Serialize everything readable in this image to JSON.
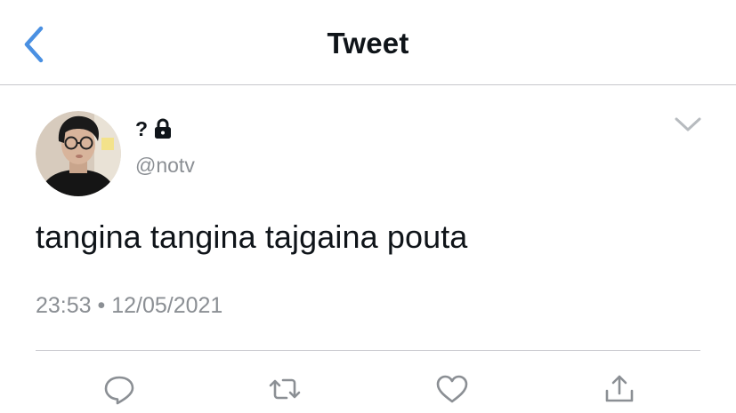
{
  "header": {
    "title": "Tweet",
    "back_icon": "chevron-left-icon",
    "accent_color": "#4a90e2"
  },
  "tweet": {
    "display_name": "?",
    "lock_icon": "lock-icon",
    "handle": "@notv",
    "text": "tangina tangina tajgaina pouta",
    "timestamp": "23:53 • 12/05/2021",
    "caret_icon": "chevron-down-icon"
  },
  "actions": [
    {
      "icon": "reply-icon"
    },
    {
      "icon": "retweet-icon"
    },
    {
      "icon": "like-icon"
    },
    {
      "icon": "share-icon"
    }
  ],
  "colors": {
    "text_primary": "#0f1419",
    "text_secondary": "#8b8f94",
    "divider": "#c7c7cc",
    "icon_gray": "#8b8f94"
  }
}
